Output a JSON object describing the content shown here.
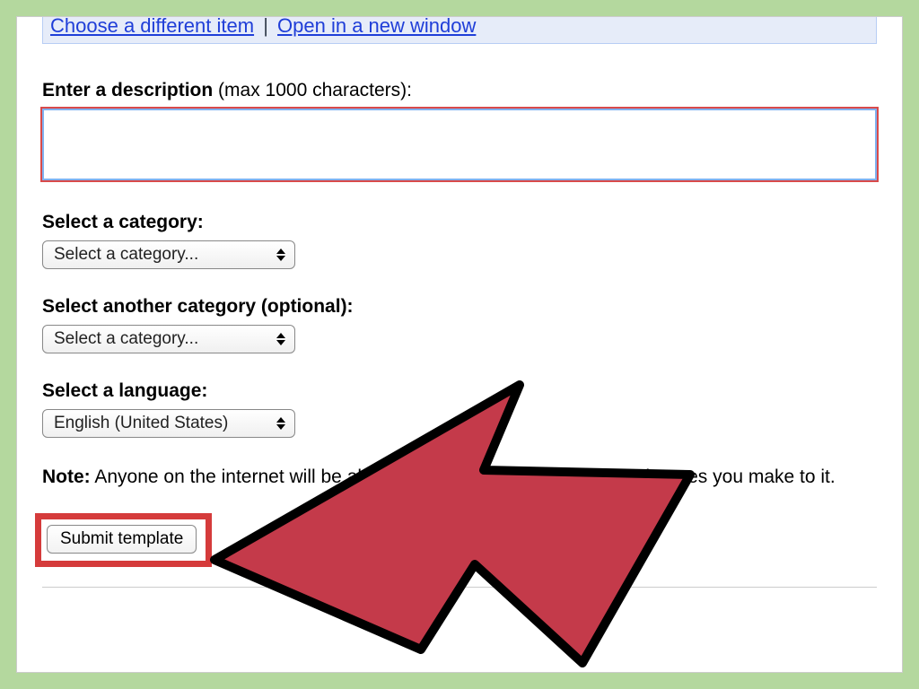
{
  "linkbar": {
    "choose_label": "Choose a different item",
    "open_label": "Open in a new window",
    "separator": "|"
  },
  "description": {
    "label_bold": "Enter a description",
    "label_light": " (max 1000 characters):",
    "value": ""
  },
  "category1": {
    "label": "Select a category:",
    "selected": "Select a category..."
  },
  "category2": {
    "label": "Select another category (optional):",
    "selected": "Select a category..."
  },
  "language": {
    "label": "Select a language:",
    "selected": "English (United States)"
  },
  "note": {
    "prefix": "Note:",
    "body": " Anyone on the internet will be able to find your template and any changes you make to it."
  },
  "submit": {
    "label": "Submit template"
  },
  "colors": {
    "highlight_border": "#d53b3b",
    "arrow_fill": "#c43a4a"
  }
}
